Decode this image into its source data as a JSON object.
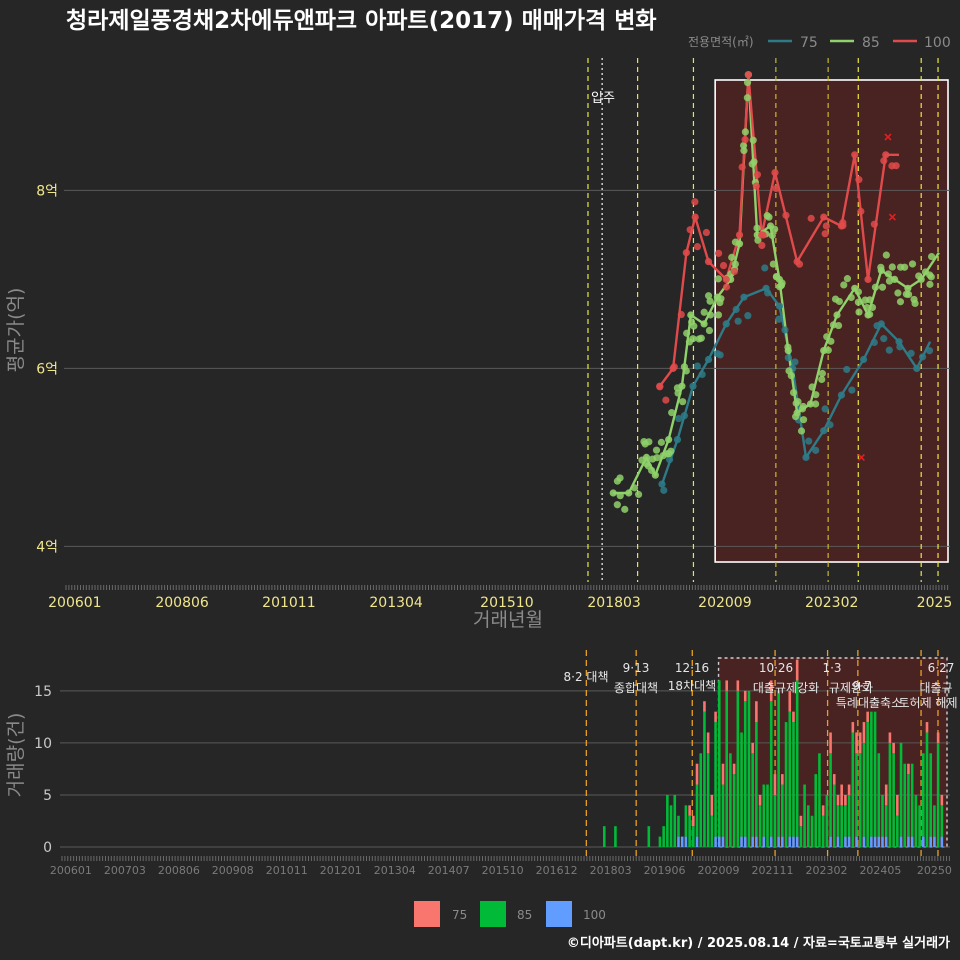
{
  "title": "청라제일풍경채2차에듀앤파크 아파트(2017) 매매가격 변화",
  "footer": "©디아파트(dapt.kr) / 2025.08.14 / 자료=국토교통부 실거래가",
  "colors": {
    "s75": "#2e7b87",
    "s85": "#8fd16a",
    "s100": "#e04a4a",
    "b75": "#f8766d",
    "b85": "#00ba38",
    "b100": "#619cff"
  },
  "chart_data": [
    {
      "type": "line",
      "xlabel": "거래년월",
      "ylabel": "평균가(억)",
      "legend": {
        "title": "전용면적(㎡)",
        "entries": [
          "75",
          "85",
          "100"
        ],
        "position": "top-right"
      },
      "x_ticks": [
        "200601",
        "200806",
        "201011",
        "201304",
        "201510",
        "201803",
        "202009",
        "202302",
        "2025"
      ],
      "y_ticks": [
        "4억",
        "6억",
        "8억"
      ],
      "ylim": [
        3.6,
        9.6
      ],
      "xlim": [
        2005.8,
        2025.75
      ],
      "annotation": "입주",
      "series": [
        {
          "name": "75",
          "points": [
            [
              2019.25,
              4.7
            ],
            [
              2019.6,
              5.2
            ],
            [
              2019.95,
              5.8
            ],
            [
              2020.3,
              6.1
            ],
            [
              2020.7,
              6.5
            ],
            [
              2021.1,
              6.8
            ],
            [
              2021.6,
              6.9
            ],
            [
              2021.9,
              6.7
            ],
            [
              2022.2,
              6.0
            ],
            [
              2022.5,
              5.0
            ],
            [
              2022.9,
              5.3
            ],
            [
              2023.3,
              5.7
            ],
            [
              2023.8,
              6.1
            ],
            [
              2024.2,
              6.5
            ],
            [
              2024.6,
              6.3
            ],
            [
              2025.0,
              6.0
            ],
            [
              2025.3,
              6.3
            ]
          ]
        },
        {
          "name": "85",
          "points": [
            [
              2018.15,
              4.6
            ],
            [
              2018.5,
              4.6
            ],
            [
              2018.9,
              5.0
            ],
            [
              2019.1,
              4.8
            ],
            [
              2019.4,
              5.2
            ],
            [
              2019.7,
              5.8
            ],
            [
              2019.9,
              6.6
            ],
            [
              2020.2,
              6.5
            ],
            [
              2020.5,
              6.8
            ],
            [
              2020.8,
              7.0
            ],
            [
              2021.0,
              7.4
            ],
            [
              2021.2,
              9.3
            ],
            [
              2021.4,
              7.5
            ],
            [
              2021.7,
              7.6
            ],
            [
              2021.9,
              7.0
            ],
            [
              2022.1,
              6.2
            ],
            [
              2022.3,
              5.5
            ],
            [
              2022.6,
              5.6
            ],
            [
              2022.9,
              6.2
            ],
            [
              2023.2,
              6.6
            ],
            [
              2023.6,
              6.9
            ],
            [
              2023.9,
              6.6
            ],
            [
              2024.2,
              7.1
            ],
            [
              2024.5,
              7.0
            ],
            [
              2024.8,
              6.9
            ],
            [
              2025.1,
              7.0
            ],
            [
              2025.5,
              7.3
            ]
          ]
        },
        {
          "name": "100",
          "points": [
            [
              2019.2,
              5.8
            ],
            [
              2019.5,
              6.0
            ],
            [
              2019.8,
              7.3
            ],
            [
              2020.0,
              7.7
            ],
            [
              2020.3,
              7.2
            ],
            [
              2020.7,
              7.0
            ],
            [
              2021.0,
              7.5
            ],
            [
              2021.2,
              9.3
            ],
            [
              2021.5,
              7.5
            ],
            [
              2021.8,
              8.2
            ],
            [
              2022.3,
              7.2
            ],
            [
              2022.9,
              7.7
            ],
            [
              2023.3,
              7.6
            ],
            [
              2023.6,
              8.4
            ],
            [
              2023.9,
              7.0
            ],
            [
              2024.3,
              8.4
            ],
            [
              2024.6,
              8.4
            ]
          ]
        }
      ],
      "cancelled": [
        [
          2023.75,
          5.0
        ],
        [
          2024.35,
          8.6
        ],
        [
          2024.45,
          7.7
        ]
      ],
      "highlight_range": [
        2020.45,
        2025.8
      ]
    },
    {
      "type": "bar",
      "xlabel": "",
      "ylabel": "거래량(건)",
      "y_ticks": [
        "0",
        "5",
        "10",
        "15"
      ],
      "ylim": [
        0,
        17
      ],
      "x_ticks": [
        "200601",
        "200703",
        "200806",
        "200908",
        "201011",
        "201201",
        "201304",
        "201407",
        "201510",
        "201612",
        "201803",
        "201906",
        "202009",
        "202111",
        "202302",
        "202405",
        "20250"
      ],
      "legend": {
        "entries": [
          "75",
          "85",
          "100"
        ],
        "position": "bottom"
      },
      "policy_labels": [
        {
          "date": "8·2 대책",
          "x": 2017.58
        },
        {
          "date": "9·13",
          "label": "종합대책",
          "x": 2018.7
        },
        {
          "date": "12·16",
          "label": "18차대책",
          "x": 2019.96
        },
        {
          "date": "10·26",
          "label": "대출규제강화",
          "x": 2021.82
        },
        {
          "date": "1·3",
          "label": "규제완화",
          "x": 2023.0
        },
        {
          "date": "9·7",
          "label": "특례대출축소",
          "x": 2023.68
        },
        {
          "date": "",
          "label": "토허제 해제",
          "x": 2025.1
        },
        {
          "date": "6·27",
          "label": "대출규",
          "x": 2025.48
        }
      ]
    }
  ]
}
